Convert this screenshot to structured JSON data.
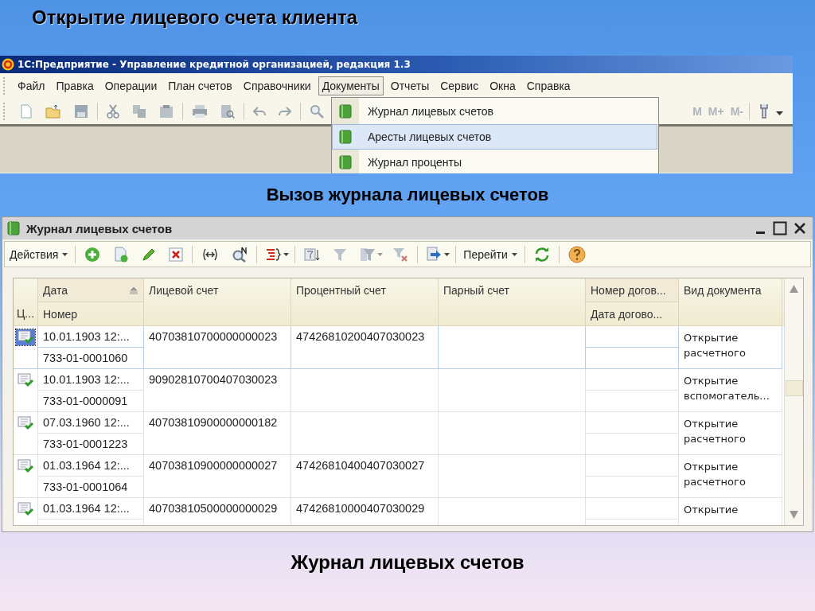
{
  "slide_title": "Открытие лицевого счета клиента",
  "main_window": {
    "title": "1С:Предприятие - Управление кредитной организацией, редакция 1.3",
    "menu": [
      {
        "label": "Файл",
        "selected": false
      },
      {
        "label": "Правка",
        "selected": false
      },
      {
        "label": "Операции",
        "selected": false
      },
      {
        "label": "План счетов",
        "selected": false
      },
      {
        "label": "Справочники",
        "selected": false
      },
      {
        "label": "Документы",
        "selected": true
      },
      {
        "label": "Отчеты",
        "selected": false
      },
      {
        "label": "Сервис",
        "selected": false
      },
      {
        "label": "Окна",
        "selected": false
      },
      {
        "label": "Справка",
        "selected": false
      }
    ],
    "memory_buttons": [
      {
        "label": "M",
        "disabled": true
      },
      {
        "label": "M+",
        "disabled": true
      },
      {
        "label": "M-",
        "disabled": true
      }
    ],
    "dropdown": [
      {
        "label": "Журнал лицевых счетов",
        "selected": false
      },
      {
        "label": "Аресты лицевых счетов",
        "selected": true
      },
      {
        "label": "Журнал проценты",
        "selected": false
      }
    ]
  },
  "caption_1": "Вызов журнала лицевых счетов",
  "journal_window": {
    "title": "Журнал лицевых счетов",
    "toolbar": {
      "actions": "Действия",
      "goto": "Перейти"
    },
    "table": {
      "columns": [
        {
          "bottom": "Ц..."
        },
        {
          "top": "Дата",
          "bottom": "Номер",
          "sorted": true
        },
        {
          "top": "Лицевой счет"
        },
        {
          "top": "Процентный счет"
        },
        {
          "top": "Парный счет"
        },
        {
          "top": "Номер догов...",
          "bottom": "Дата догово..."
        },
        {
          "top": "Вид документа"
        }
      ],
      "rows": [
        {
          "selected": true,
          "date": "10.01.1903 12:...",
          "number": "733-01-0001060",
          "account": "40703810700000000023",
          "interest_account": "47426810200407030023",
          "doc_type": "Открытие расчетного"
        },
        {
          "selected": false,
          "date": "10.01.1903 12:...",
          "number": "733-01-0000091",
          "account": "90902810700407030023",
          "doc_type": "Открытие вспомогатель..."
        },
        {
          "selected": false,
          "date": "07.03.1960 12:...",
          "number": "733-01-0001223",
          "account": "40703810900000000182",
          "doc_type": "Открытие расчетного"
        },
        {
          "selected": false,
          "date": "01.03.1964 12:...",
          "number": "733-01-0001064",
          "account": "40703810900000000027",
          "interest_account": "47426810400407030027",
          "doc_type": "Открытие расчетного"
        },
        {
          "selected": false,
          "date": "01.03.1964 12:...",
          "account": "40703810500000000029",
          "interest_account": "47426810000407030029",
          "doc_type": "Открытие"
        }
      ]
    }
  },
  "caption_2": "Журнал лицевых счетов"
}
